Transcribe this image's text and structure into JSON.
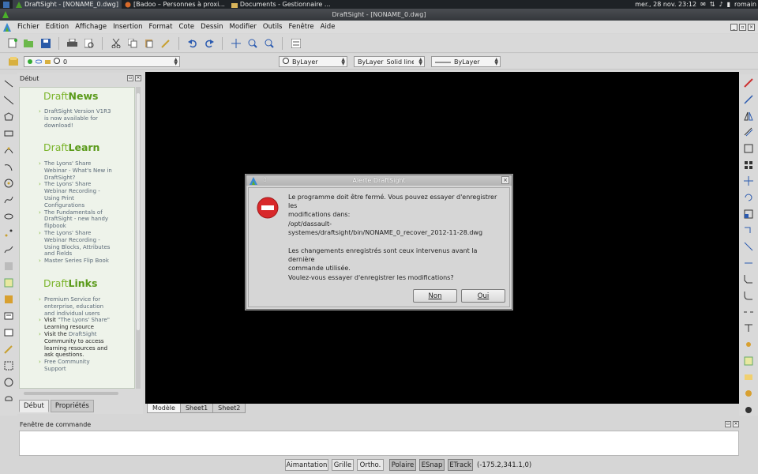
{
  "taskbar": {
    "tasks": [
      {
        "label": "DraftSight - [NONAME_0.dwg]"
      },
      {
        "label": "[Badoo – Personnes à proxi..."
      },
      {
        "label": "Documents - Gestionnaire ..."
      }
    ],
    "datetime": "mer., 28 nov.  23:12",
    "user": "romain"
  },
  "window": {
    "title": "DraftSight - [NONAME_0.dwg]"
  },
  "menu": {
    "items": [
      "Fichier",
      "Edition",
      "Affichage",
      "Insertion",
      "Format",
      "Cote",
      "Dessin",
      "Modifier",
      "Outils",
      "Fenêtre",
      "Aide"
    ]
  },
  "layers": {
    "current": "0",
    "color": "ByLayer",
    "linetype_scope": "ByLayer",
    "linetype": "Solid line",
    "lineweight": "ByLayer"
  },
  "start_panel": {
    "title": "Début",
    "news_title_prefix": "Draft",
    "news_title_suffix": "News",
    "news_items": [
      "DraftSight Version V1R3 is now available for download!"
    ],
    "learn_title_prefix": "Draft",
    "learn_title_suffix": "Learn",
    "learn_items": [
      "The Lyons' Share Webinar - What's New in DraftSight?",
      "The Lyons' Share Webinar Recording - Using Print Configurations",
      "The Fundamentals of DraftSight - new handy flipbook",
      "The Lyons' Share Webinar Recording - Using Blocks, Attributes and Fields",
      "Master Series Flip Book"
    ],
    "links_title_prefix": "Draft",
    "links_title_suffix": "Links",
    "links_items": [
      {
        "pre": "",
        "link": "Premium Service for enterprise, education and individual users",
        "post": ""
      },
      {
        "pre": "Visit ",
        "link": "\"The Lyons' Share\"",
        "post": " Learning resource"
      },
      {
        "pre": "Visit the ",
        "link": "DraftSight",
        "post": " Community to access learning resources and ask questions."
      },
      {
        "pre": "",
        "link": "Free Community Support",
        "post": ""
      }
    ],
    "tabs": [
      "Début",
      "Propriétés"
    ]
  },
  "sheets": [
    "Modèle",
    "Sheet1",
    "Sheet2"
  ],
  "command": {
    "title": "Fenêtre de commande"
  },
  "status": {
    "buttons": [
      "Aimantation",
      "Grille",
      "Ortho.",
      "Polaire",
      "ESnap",
      "ETrack"
    ],
    "coords": "(-175.2,341.1,0)"
  },
  "dialog": {
    "title": "Alerte DraftSight",
    "line1": "Le programme doit être fermé. Vous pouvez essayer d'enregistrer les",
    "line2": "modifications dans:",
    "path1": "/opt/dassault-",
    "path2": "systemes/draftsight/bin/NONAME_0_recover_2012-11-28.dwg",
    "line3": "Les changements enregistrés sont ceux intervenus avant la dernière",
    "line4": "commande utilisée.",
    "question": "Voulez-vous essayer d'enregistrer les modifications?",
    "no_label": "Non",
    "yes_label": "Oui"
  }
}
